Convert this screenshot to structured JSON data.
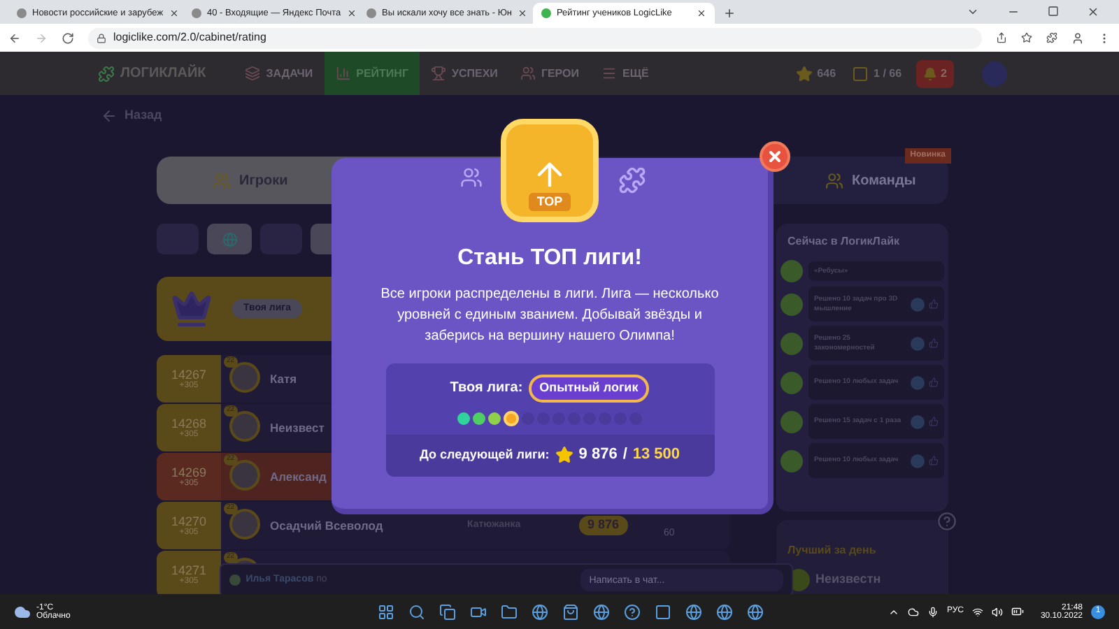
{
  "browser": {
    "tabs": [
      {
        "title": "Новости российские и зарубеж",
        "selected": false
      },
      {
        "title": "40 - Входящие — Яндекс Почта",
        "selected": false
      },
      {
        "title": "Вы искали хочу все знать - Юн",
        "selected": false
      },
      {
        "title": "Рейтинг учеников LogicLike",
        "selected": true
      }
    ],
    "url": "logiclike.com/2.0/cabinet/rating"
  },
  "nav": {
    "logo": "ЛОГИКЛАЙК",
    "items": [
      {
        "label": "ЗАДАЧИ",
        "selected": false
      },
      {
        "label": "РЕЙТИНГ",
        "selected": true
      },
      {
        "label": "УСПЕХИ",
        "selected": false
      },
      {
        "label": "ГЕРОИ",
        "selected": false
      },
      {
        "label": "ЕЩЁ",
        "selected": false
      }
    ],
    "stars": "646",
    "progress": "1 / 66",
    "notifications": "2"
  },
  "page": {
    "back": "Назад",
    "tabs": [
      {
        "label": "Игроки",
        "selected": true
      },
      {
        "label": "Команды",
        "selected": false,
        "badge": "Новинка"
      }
    ],
    "league_label": "Твоя лига",
    "rows": [
      {
        "rank": "14267",
        "delta": "+305",
        "level": "22",
        "name": "Катя",
        "selected": false
      },
      {
        "rank": "14268",
        "delta": "+305",
        "level": "22",
        "name": "Неизвест",
        "selected": false
      },
      {
        "rank": "14269",
        "delta": "+305",
        "level": "22",
        "name": "Александ",
        "selected": true
      },
      {
        "rank": "14270",
        "delta": "+305",
        "level": "22",
        "name": "Осадчий Всеволод",
        "team": "Катюжанка",
        "stars": "9 876",
        "count": "60",
        "selected": false
      },
      {
        "rank": "14271",
        "delta": "+305",
        "level": "22",
        "selected": false
      }
    ],
    "chat": {
      "author": "Илья Тарасов",
      "message": "по",
      "placeholder": "Написать в чат..."
    },
    "feed": {
      "title": "Сейчас в ЛогикЛайк",
      "items": [
        {
          "text": "«Ребусы»"
        },
        {
          "text": "Решено 10 задач про 3D мышление"
        },
        {
          "text": "Решено 25 закономерностей"
        },
        {
          "text": "Решено 10 любых задач"
        },
        {
          "text": "Решено 15 задач с 1 раза"
        },
        {
          "text": "Решено 10 любых задач"
        }
      ]
    },
    "best": {
      "title": "Лучший за день",
      "name": "Неизвестн"
    }
  },
  "modal": {
    "badge": "TOP",
    "title": "Стань ТОП лиги!",
    "text": "Все игроки распределены в лиги. Лига — несколько уровней с единым званием. Добывай звёзды и заберись на вершину нашего Олимпа!",
    "league_label": "Твоя лига:",
    "league": "Опытный логик",
    "leagues": [
      {
        "color": "#2fd39b",
        "selected": false
      },
      {
        "color": "#4fcf63",
        "selected": false
      },
      {
        "color": "#8fd14a",
        "selected": false
      },
      {
        "color": "#f5a623",
        "selected": true
      },
      {
        "color": "#4a3a9c",
        "selected": false
      },
      {
        "color": "#4a3a9c",
        "selected": false
      },
      {
        "color": "#4a3a9c",
        "selected": false
      },
      {
        "color": "#4a3a9c",
        "selected": false
      },
      {
        "color": "#4a3a9c",
        "selected": false
      },
      {
        "color": "#4a3a9c",
        "selected": false
      },
      {
        "color": "#4a3a9c",
        "selected": false
      },
      {
        "color": "#4a3a9c",
        "selected": false
      }
    ],
    "next_label": "До следующей лиги:",
    "current": "9 876",
    "separator": "/",
    "target": "13 500"
  },
  "taskbar": {
    "temperature": "-1°C",
    "weather": "Облачно",
    "language": "РУС",
    "time": "21:48",
    "date": "30.10.2022",
    "notifications": "1"
  }
}
